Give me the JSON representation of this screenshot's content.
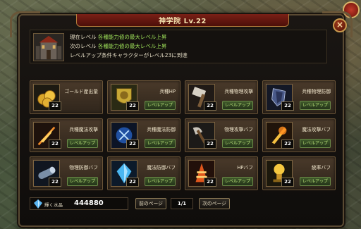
{
  "window": {
    "title": "神学院 Lv.22",
    "close_label": "×"
  },
  "info": {
    "line1_prefix": "現在レベル",
    "line1_value": "各種能力値の最大レベル上昇",
    "line2_prefix": "次のレベル",
    "line2_value": "各種能力値の最大レベル上昇",
    "line3": "レベルアップ条件キャラクターがレベル23に到達"
  },
  "grid": {
    "upgrade_label": "レベルアップ",
    "cells": [
      {
        "name": "ゴールド産出量",
        "level": "22",
        "icon": "gold-coins-icon"
      },
      {
        "name": "兵種HP",
        "level": "22",
        "icon": "lion-shield-icon"
      },
      {
        "name": "兵種物理攻撃",
        "level": "22",
        "icon": "hammer-icon"
      },
      {
        "name": "兵種物理防御",
        "level": "22",
        "icon": "shield-icon"
      },
      {
        "name": "兵種魔法攻撃",
        "level": "22",
        "icon": "flaming-sword-icon"
      },
      {
        "name": "兵種魔法防御",
        "level": "22",
        "icon": "magic-shield-icon"
      },
      {
        "name": "物理攻撃バフ",
        "level": "22",
        "icon": "battle-axe-icon"
      },
      {
        "name": "魔法攻撃バフ",
        "level": "22",
        "icon": "fire-blade-icon"
      },
      {
        "name": "物理防御バフ",
        "level": "22",
        "icon": "steel-pipe-icon"
      },
      {
        "name": "魔法防御バフ",
        "level": "22",
        "icon": "blue-crystal-icon"
      },
      {
        "name": "HPバフ",
        "level": "22",
        "icon": "red-tower-icon"
      },
      {
        "name": "統率バフ",
        "level": "22",
        "icon": "golden-trophy-icon"
      }
    ]
  },
  "footer": {
    "crystal_label": "輝く水晶",
    "crystal_value": "444880",
    "prev_label": "前のページ",
    "page": "1/1",
    "next_label": "次のページ"
  }
}
